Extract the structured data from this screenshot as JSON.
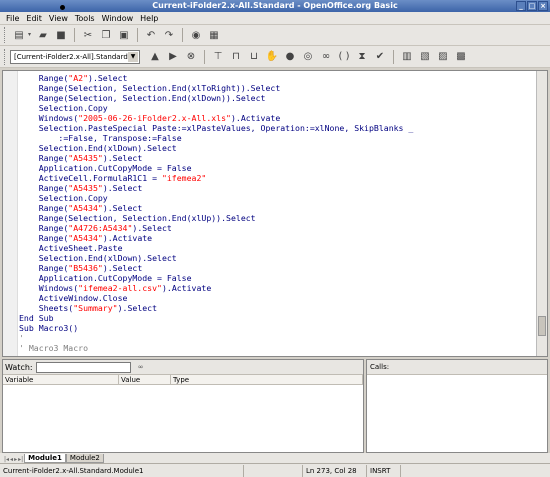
{
  "window": {
    "title": "Current-iFolder2.x-All.Standard - OpenOffice.org Basic"
  },
  "menu": [
    "File",
    "Edit",
    "View",
    "Tools",
    "Window",
    "Help"
  ],
  "toolbar": {
    "library_select": "[Current-iFolder2.x-All].Standard"
  },
  "code_lines": [
    [
      [
        "    Range(",
        "kw"
      ],
      [
        "\"A2\"",
        "str"
      ],
      [
        ").Select",
        "kw"
      ]
    ],
    [
      [
        "    Range(Selection, Selection.End(xlToRight)).Select",
        "kw"
      ]
    ],
    [
      [
        "    Range(Selection, Selection.End(xlDown)).Select",
        "kw"
      ]
    ],
    [
      [
        "    Selection.Copy",
        "kw"
      ]
    ],
    [
      [
        "    Windows(",
        "kw"
      ],
      [
        "\"2005-06-26-iFolder2.x-All.xls\"",
        "str"
      ],
      [
        ").Activate",
        "kw"
      ]
    ],
    [
      [
        "    Selection.PasteSpecial Paste:=xlPasteValues, Operation:=xlNone, SkipBlanks _",
        "kw"
      ]
    ],
    [
      [
        "        :=False, Transpose:=False",
        "kw"
      ]
    ],
    [
      [
        "    Selection.End(xlDown).Select",
        "kw"
      ]
    ],
    [
      [
        "    Range(",
        "kw"
      ],
      [
        "\"A5435\"",
        "str"
      ],
      [
        ").Select",
        "kw"
      ]
    ],
    [
      [
        "    Application.CutCopyMode = False",
        "kw"
      ]
    ],
    [
      [
        "    ActiveCell.FormulaR1C1 = ",
        "kw"
      ],
      [
        "\"ifemea2\"",
        "str"
      ]
    ],
    [
      [
        "    Range(",
        "kw"
      ],
      [
        "\"A5435\"",
        "str"
      ],
      [
        ").Select",
        "kw"
      ]
    ],
    [
      [
        "    Selection.Copy",
        "kw"
      ]
    ],
    [
      [
        "    Range(",
        "kw"
      ],
      [
        "\"A5434\"",
        "str"
      ],
      [
        ").Select",
        "kw"
      ]
    ],
    [
      [
        "    Range(Selection, Selection.End(xlUp)).Select",
        "kw"
      ]
    ],
    [
      [
        "    Range(",
        "kw"
      ],
      [
        "\"A4726:A5434\"",
        "str"
      ],
      [
        ").Select",
        "kw"
      ]
    ],
    [
      [
        "    Range(",
        "kw"
      ],
      [
        "\"A5434\"",
        "str"
      ],
      [
        ").Activate",
        "kw"
      ]
    ],
    [
      [
        "    ActiveSheet.Paste",
        "kw"
      ]
    ],
    [
      [
        "    Selection.End(xlDown).Select",
        "kw"
      ]
    ],
    [
      [
        "    Range(",
        "kw"
      ],
      [
        "\"B5436\"",
        "str"
      ],
      [
        ").Select",
        "kw"
      ]
    ],
    [
      [
        "    Application.CutCopyMode = False",
        "kw"
      ]
    ],
    [
      [
        "    Windows(",
        "kw"
      ],
      [
        "\"ifemea2-all.csv\"",
        "str"
      ],
      [
        ").Activate",
        "kw"
      ]
    ],
    [
      [
        "    ActiveWindow.Close",
        "kw"
      ]
    ],
    [
      [
        "    Sheets(",
        "kw"
      ],
      [
        "\"Summary\"",
        "str"
      ],
      [
        ").Select",
        "kw"
      ]
    ],
    [
      [
        "End Sub",
        "kw"
      ]
    ],
    [
      [
        "Sub Macro3()",
        "kw"
      ]
    ],
    [
      [
        "'",
        "cm"
      ]
    ],
    [
      [
        "' Macro3 Macro",
        "cm"
      ]
    ]
  ],
  "watch": {
    "label": "Watch:",
    "columns": [
      "Variable",
      "Value",
      "Type"
    ]
  },
  "calls": {
    "label": "Calls:"
  },
  "tabs": [
    "Module1",
    "Module2"
  ],
  "status": {
    "module": "Current-iFolder2.x-All.Standard.Module1",
    "position": "Ln 273, Col 28",
    "mode": "INSRT"
  }
}
